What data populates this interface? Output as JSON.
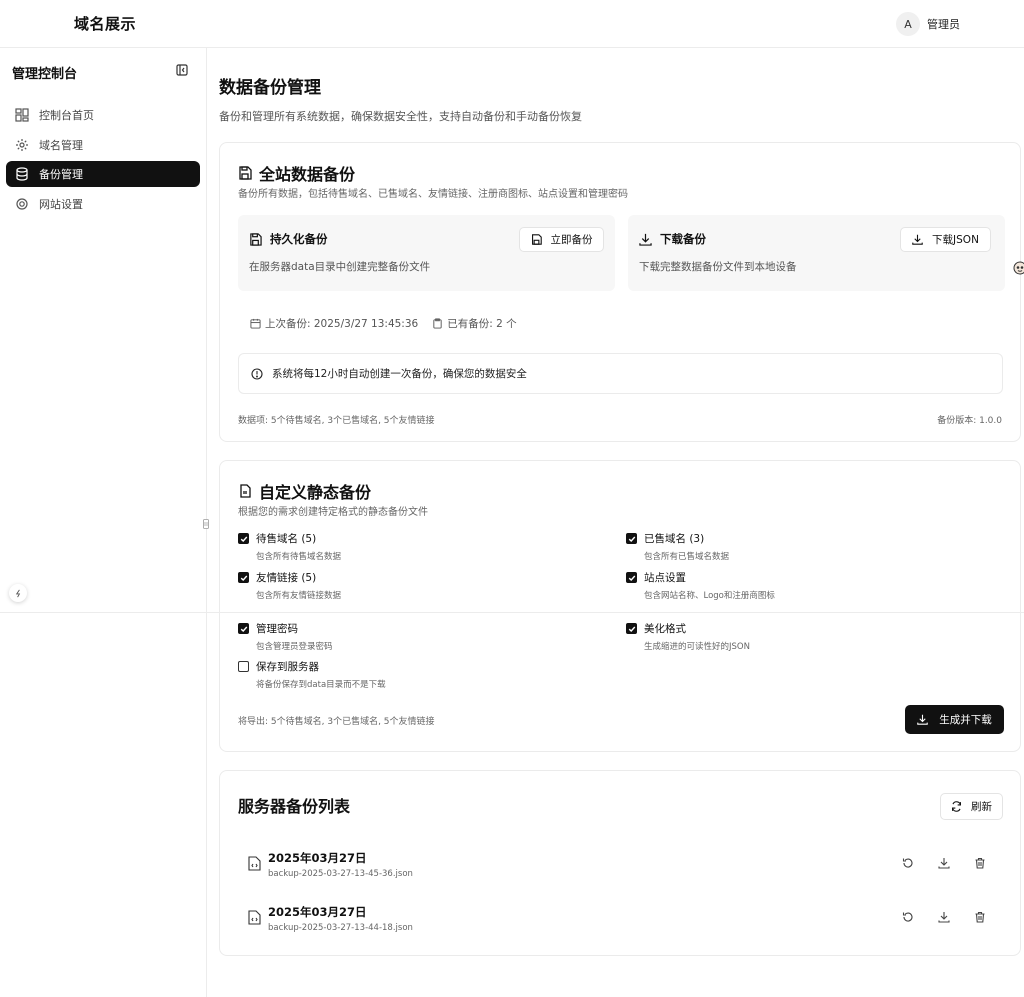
{
  "header": {
    "brand": "域名展示",
    "avatar_letter": "A",
    "user_name": "管理员"
  },
  "sidebar": {
    "title": "管理控制台",
    "items": [
      {
        "label": "控制台首页",
        "icon": "dashboard-icon",
        "active": false
      },
      {
        "label": "域名管理",
        "icon": "gear-icon",
        "active": false
      },
      {
        "label": "备份管理",
        "icon": "database-icon",
        "active": true
      },
      {
        "label": "网站设置",
        "icon": "cog-icon",
        "active": false
      }
    ]
  },
  "page": {
    "title": "数据备份管理",
    "description": "备份和管理所有系统数据，确保数据安全性，支持自动备份和手动备份恢复"
  },
  "full_backup": {
    "title": "全站数据备份",
    "description": "备份所有数据，包括待售域名、已售域名、友情链接、注册商图标、站点设置和管理密码",
    "persistent": {
      "title": "持久化备份",
      "description": "在服务器data目录中创建完整备份文件",
      "button": "立即备份"
    },
    "download": {
      "title": "下载备份",
      "description": "下载完整数据备份文件到本地设备",
      "button": "下载JSON"
    },
    "last_backup": "上次备份: 2025/3/27 13:45:36",
    "backup_count": "已有备份: 2 个",
    "notice": "系统将每12小时自动创建一次备份，确保您的数据安全",
    "data_items": "数据项: 5个待售域名, 3个已售域名, 5个友情链接",
    "version": "备份版本: 1.0.0"
  },
  "custom_backup": {
    "title": "自定义静态备份",
    "description": "根据您的需求创建特定格式的静态备份文件",
    "options": [
      {
        "label": "待售域名 (5)",
        "desc": "包含所有待售域名数据",
        "checked": true
      },
      {
        "label": "已售域名 (3)",
        "desc": "包含所有已售域名数据",
        "checked": true
      },
      {
        "label": "友情链接 (5)",
        "desc": "包含所有友情链接数据",
        "checked": true
      },
      {
        "label": "站点设置",
        "desc": "包含网站名称、Logo和注册商图标",
        "checked": true
      },
      {
        "label": "管理密码",
        "desc": "包含管理员登录密码",
        "checked": true
      },
      {
        "label": "美化格式",
        "desc": "生成缩进的可读性好的JSON",
        "checked": true
      },
      {
        "label": "保存到服务器",
        "desc": "将备份保存到data目录而不是下载",
        "checked": false
      }
    ],
    "export_summary": "将导出: 5个待售域名, 3个已售域名, 5个友情链接",
    "button": "生成并下载"
  },
  "server_list": {
    "title": "服务器备份列表",
    "refresh": "刷新",
    "files": [
      {
        "date": "2025年03月27日",
        "name": "backup-2025-03-27-13-45-36.json"
      },
      {
        "date": "2025年03月27日",
        "name": "backup-2025-03-27-13-44-18.json"
      }
    ]
  }
}
